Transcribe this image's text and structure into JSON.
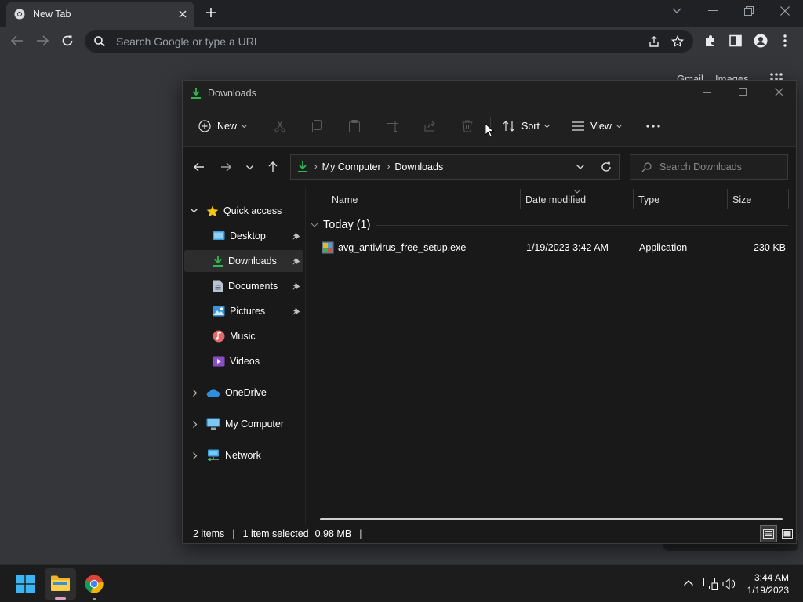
{
  "chrome": {
    "tab_title": "New Tab",
    "omnibox_placeholder": "Search Google or type a URL",
    "ntp_link_gmail": "Gmail",
    "ntp_link_images": "Images"
  },
  "explorer": {
    "title": "Downloads",
    "commands": {
      "new_label": "New",
      "sort_label": "Sort",
      "view_label": "View"
    },
    "breadcrumb": [
      "My Computer",
      "Downloads"
    ],
    "search_placeholder": "Search Downloads",
    "nav": {
      "quick_access": "Quick access",
      "items": [
        {
          "label": "Desktop",
          "pinned": true
        },
        {
          "label": "Downloads",
          "pinned": true,
          "selected": true
        },
        {
          "label": "Documents",
          "pinned": true
        },
        {
          "label": "Pictures",
          "pinned": true
        },
        {
          "label": "Music",
          "pinned": false
        },
        {
          "label": "Videos",
          "pinned": false
        }
      ],
      "onedrive": "OneDrive",
      "my_computer": "My Computer",
      "network": "Network"
    },
    "columns": [
      "Name",
      "Date modified",
      "Type",
      "Size"
    ],
    "group_header": "Today (1)",
    "files": [
      {
        "name": "avg_antivirus_free_setup.exe",
        "date_modified": "1/19/2023 3:42 AM",
        "type": "Application",
        "size": "230 KB"
      }
    ],
    "status": {
      "items": "2 items",
      "selected": "1 item selected",
      "size": "0.98 MB"
    }
  },
  "taskbar": {
    "time": "3:44 AM",
    "date": "1/19/2023"
  },
  "colors": {
    "accent_green": "#2fb84f",
    "chrome_toolbar": "#35363a",
    "explorer_bg": "#191919"
  }
}
